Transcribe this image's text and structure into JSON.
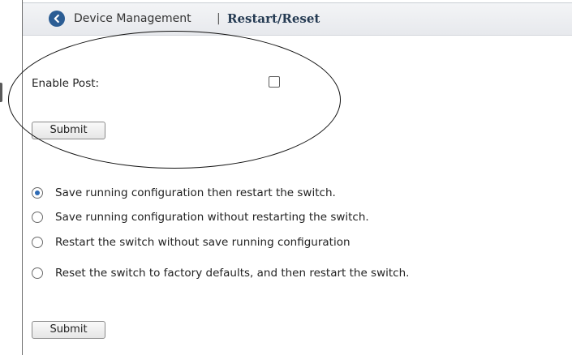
{
  "header": {
    "breadcrumb": "Device Management",
    "separator": "|",
    "title": "Restart/Reset"
  },
  "post_form": {
    "enable_post_label": "Enable Post:",
    "enable_post_checked": false,
    "submit_label": "Submit"
  },
  "restart_options": [
    {
      "label": "Save running configuration then restart the switch.",
      "selected": true
    },
    {
      "label": "Save running configuration without restarting the switch.",
      "selected": false
    },
    {
      "label": "Restart the switch without save running configuration",
      "selected": false
    },
    {
      "label": "Reset the switch to factory defaults, and then restart the switch.",
      "selected": false
    }
  ],
  "restart_form": {
    "submit_label": "Submit"
  },
  "colors": {
    "back_button": "#2b5d94",
    "radio_selected": "#2e6bb5"
  },
  "icons": {
    "back": "chevron-left-icon"
  }
}
